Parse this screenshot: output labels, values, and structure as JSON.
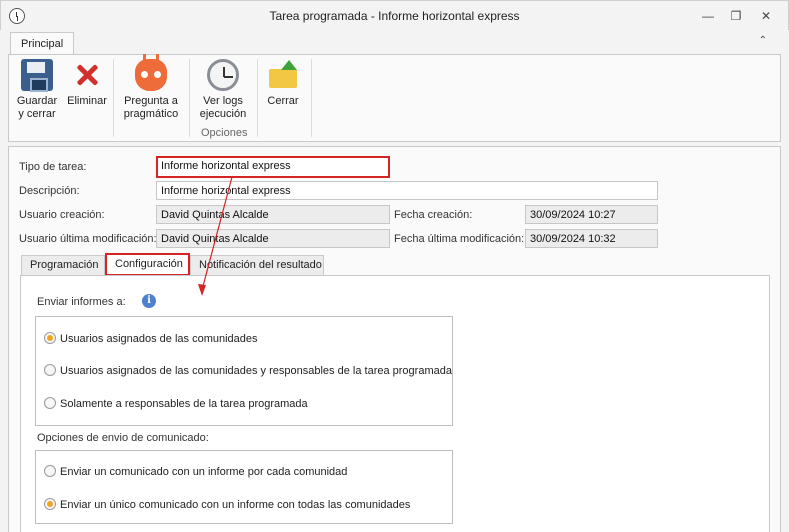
{
  "window": {
    "title": "Tarea programada - Informe horizontal express",
    "minimize": "—",
    "restore": "❐",
    "close": "✕"
  },
  "ribbon_tabs": {
    "principal": "Principal",
    "collapse": "⌃"
  },
  "ribbon": {
    "save_line1": "Guardar",
    "save_line2": "y cerrar",
    "delete": "Eliminar",
    "ask_line1": "Pregunta a",
    "ask_line2": "pragmático",
    "logs_line1": "Ver logs",
    "logs_line2": "ejecución",
    "close": "Cerrar",
    "group_label": "Opciones"
  },
  "form": {
    "task_type_label": "Tipo de tarea:",
    "task_type_value": "Informe horizontal express",
    "description_label": "Descripción:",
    "description_value": "Informe horizontal express",
    "created_user_label": "Usuario creación:",
    "created_user_value": "David Quintas Alcalde",
    "created_date_label": "Fecha creación:",
    "created_date_value": "30/09/2024 10:27",
    "modified_user_label": "Usuario última modificación:",
    "modified_user_value": "David Quintas Alcalde",
    "modified_date_label": "Fecha última modificación:",
    "modified_date_value": "30/09/2024 10:32"
  },
  "tabs": {
    "programacion": "Programación",
    "configuracion": "Configuración",
    "notificacion": "Notificación del resultado"
  },
  "config": {
    "send_reports_label": "Enviar informes a:",
    "info_icon": "i",
    "send_options": [
      "Usuarios asignados de las comunidades",
      "Usuarios asignados de las comunidades  y responsables de la tarea programada",
      "Solamente a responsables de la tarea programada"
    ],
    "send_selected": 0,
    "communique_label": "Opciones de envio de comunicado:",
    "communique_options": [
      "Enviar un comunicado con un informe por cada comunidad",
      "Enviar un único comunicado con un informe con todas las comunidades"
    ],
    "communique_selected": 1
  },
  "colors": {
    "highlight": "#d42424",
    "radio_selected": "#f0a41e",
    "info": "#4f7fcf"
  }
}
